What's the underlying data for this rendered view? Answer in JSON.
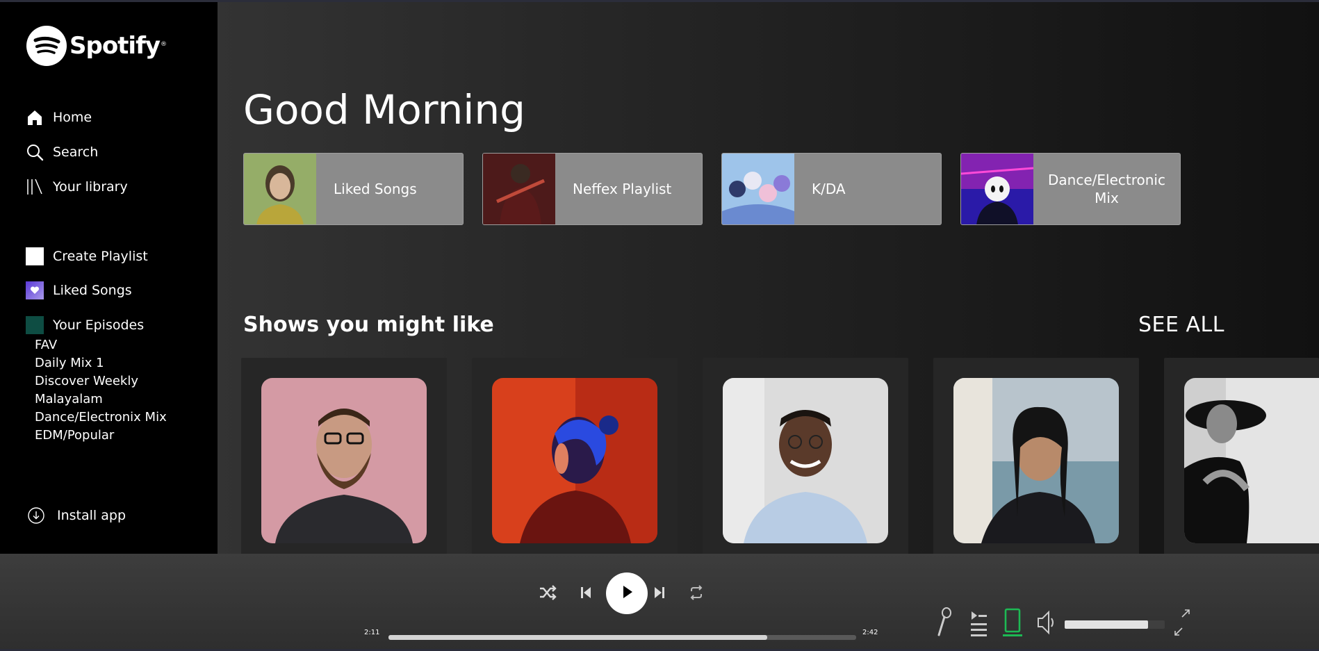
{
  "app": {
    "logo_text": "Spotify",
    "logo_reg": "®"
  },
  "sidebar": {
    "nav": [
      {
        "label": "Home",
        "icon": "home-icon"
      },
      {
        "label": "Search",
        "icon": "search-icon"
      },
      {
        "label": "Your library",
        "icon": "library-icon"
      }
    ],
    "actions": [
      {
        "label": "Create Playlist",
        "icon": "create-playlist-icon"
      },
      {
        "label": "Liked Songs",
        "icon": "liked-songs-icon"
      },
      {
        "label": "Your Episodes",
        "icon": "episodes-icon"
      }
    ],
    "playlists": [
      "FAV",
      "Daily Mix 1",
      "Discover Weekly",
      "Malayalam",
      "Dance/Electronix Mix",
      "EDM/Popular"
    ],
    "install": {
      "label": "Install app",
      "icon": "download-circle-icon"
    }
  },
  "main": {
    "greeting": "Good Morning",
    "quick_cards": [
      {
        "label": "Liked Songs"
      },
      {
        "label": "Neffex Playlist"
      },
      {
        "label": "K/DA"
      },
      {
        "label": "Dance/Electronic Mix"
      }
    ],
    "shows_title": "Shows you might like",
    "see_all": "SEE ALL",
    "show_count_visible": 5
  },
  "player": {
    "current_time": "2:11",
    "total_time": "2:42",
    "progress": 0.81,
    "volume": 0.83,
    "controls": [
      "shuffle-icon",
      "previous-icon",
      "play-icon",
      "next-icon",
      "repeat-icon"
    ],
    "right_controls": [
      "microphone-icon",
      "queue-icon",
      "device-icon",
      "volume-icon",
      "fullscreen-icon"
    ],
    "colors": {
      "accent": "#1db954",
      "card": "#8b8b8b"
    }
  }
}
